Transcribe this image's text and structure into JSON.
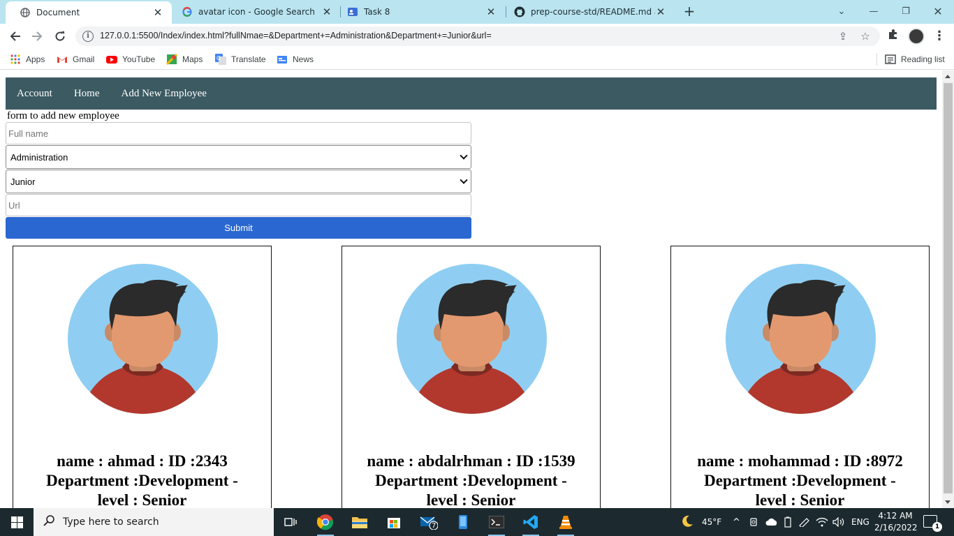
{
  "browser": {
    "tabs": [
      {
        "title": "Document",
        "icon": "globe-icon",
        "active": true
      },
      {
        "title": "avatar icon - Google Search",
        "icon": "google-icon",
        "active": false
      },
      {
        "title": "Task 8",
        "icon": "task-icon",
        "active": false
      },
      {
        "title": "prep-course-std/README.md at",
        "icon": "github-icon",
        "active": false
      }
    ],
    "address": "127.0.0.1:5500/Index/index.html?fullNmae=&Department+=Administration&Department+=Junior&url=",
    "bookmarks": [
      "Apps",
      "Gmail",
      "YouTube",
      "Maps",
      "Translate",
      "News"
    ],
    "reading_list": "Reading list"
  },
  "site": {
    "nav": [
      "Account",
      "Home",
      "Add New Employee"
    ],
    "form": {
      "caption": "form to add new employee",
      "fullname_placeholder": "Full name",
      "department_value": "Administration",
      "level_value": "Junior",
      "url_placeholder": "Url",
      "submit_label": "Submit"
    },
    "employees": [
      {
        "line1": "name : ahmad : ID :2343",
        "line2": "Department :Development -",
        "line3": "level : Senior"
      },
      {
        "line1": "name : abdalrhman : ID :1539",
        "line2": "Department :Development -",
        "line3": "level : Senior"
      },
      {
        "line1": "name : mohammad : ID :8972",
        "line2": "Department :Development -",
        "line3": "level : Senior"
      }
    ]
  },
  "taskbar": {
    "search_placeholder": "Type here to search",
    "weather": "45°F",
    "language": "ENG",
    "time": "4:12 AM",
    "date": "2/16/2022",
    "mail_badge": "7",
    "notification_count": "1"
  },
  "colors": {
    "nav_bg": "#3b5a62",
    "submit_bg": "#2a67d0",
    "tabstrip_bg": "#b9e4f0",
    "taskbar_bg": "#1c2a30"
  }
}
